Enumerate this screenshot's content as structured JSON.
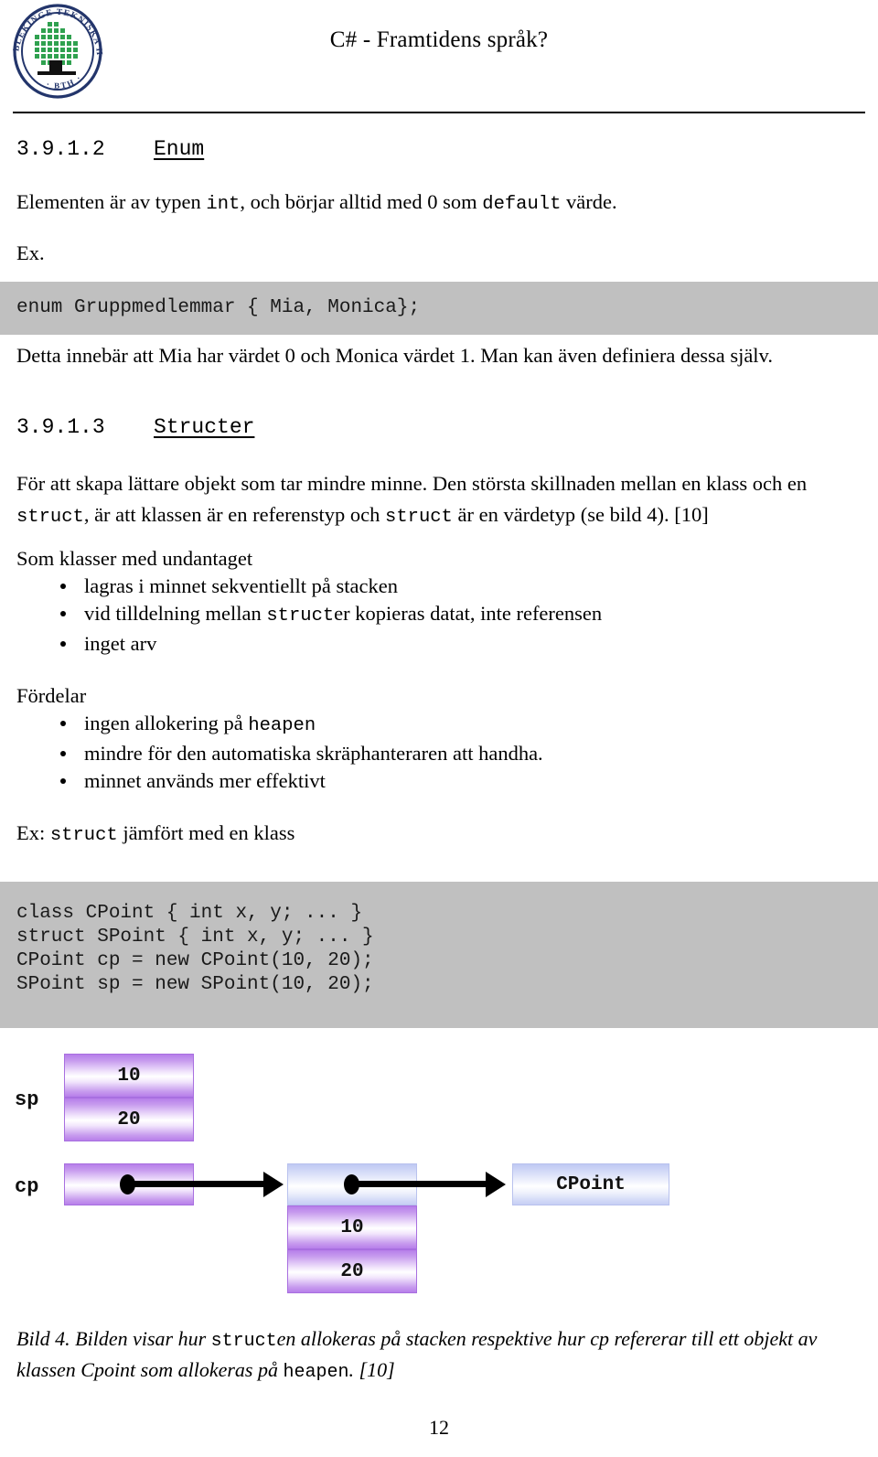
{
  "header": {
    "title": "C# - Framtidens språk?",
    "logo_alt": "Blekinge Tekniska Högskola BTH seal",
    "logo_text_top": "BLEKINGE TEKNISKA HÖGSKOLA",
    "logo_text_bottom": "BTH"
  },
  "sections": [
    {
      "number": "3.9.1.2",
      "title": "Enum",
      "paragraphs": [
        {
          "id": "enum_intro",
          "runs": [
            {
              "t": "Elementen är av typen ",
              "mono": false
            },
            {
              "t": "int",
              "mono": true
            },
            {
              "t": ", och börjar alltid med 0 som ",
              "mono": false
            },
            {
              "t": "default",
              "mono": true
            },
            {
              "t": " värde.",
              "mono": false
            }
          ]
        },
        {
          "id": "ex_label",
          "runs": [
            {
              "t": "Ex.",
              "mono": false
            }
          ]
        }
      ],
      "code": "enum Gruppmedlemmar { Mia, Monica};",
      "after_code": {
        "runs": [
          {
            "t": "Detta innebär att Mia har värdet 0 och Monica värdet 1. Man kan även definiera dessa själv.",
            "mono": false
          }
        ]
      }
    },
    {
      "number": "3.9.1.3",
      "title": "Structer",
      "paragraphs": [
        {
          "id": "struct_intro",
          "runs": [
            {
              "t": "För att skapa lättare objekt som tar mindre minne. Den största skillnaden mellan en klass och en ",
              "mono": false
            },
            {
              "t": "struct",
              "mono": true
            },
            {
              "t": ", är att klassen är en referenstyp och ",
              "mono": false
            },
            {
              "t": "struct",
              "mono": true
            },
            {
              "t": " är en värdetyp (se bild 4). [10]",
              "mono": false
            }
          ]
        }
      ]
    }
  ],
  "lists": [
    {
      "id": "som_klasser",
      "intro": "Som klasser med undantaget",
      "items": [
        [
          {
            "t": "lagras i minnet sekventiellt på stacken",
            "mono": false
          }
        ],
        [
          {
            "t": "vid tilldelning mellan ",
            "mono": false
          },
          {
            "t": "struct",
            "mono": true
          },
          {
            "t": "er kopieras datat, inte referensen",
            "mono": false
          }
        ],
        [
          {
            "t": "inget arv",
            "mono": false
          }
        ]
      ]
    },
    {
      "id": "fordelar",
      "intro": "Fördelar",
      "items": [
        [
          {
            "t": "ingen allokering på ",
            "mono": false
          },
          {
            "t": "heapen",
            "mono": true
          }
        ],
        [
          {
            "t": "mindre för den automatiska skräphanteraren att handha.",
            "mono": false
          }
        ],
        [
          {
            "t": "minnet används mer effektivt",
            "mono": false
          }
        ]
      ]
    }
  ],
  "example_intro": {
    "runs": [
      {
        "t": "Ex: ",
        "mono": false
      },
      {
        "t": "struct",
        "mono": true
      },
      {
        "t": " jämfört med en klass",
        "mono": false
      }
    ]
  },
  "code_block": "class CPoint { int x, y; ... }\nstruct SPoint { int x, y; ... }\nCPoint cp = new CPoint(10, 20);\nSPoint sp = new SPoint(10, 20);",
  "diagram": {
    "stack_var_label": "sp",
    "heap_var_label": "cp",
    "sp_values": [
      "10",
      "20"
    ],
    "heap_object_values": [
      "10",
      "20"
    ],
    "class_box_label": "CPoint",
    "colors": {
      "value_box": "#b47ae9",
      "reference_box": "#bcc6f2",
      "arrow": "#000000"
    }
  },
  "caption": {
    "runs": [
      {
        "t": "Bild 4. Bilden visar hur ",
        "mono": false
      },
      {
        "t": "struct",
        "mono": true
      },
      {
        "t": "en allokeras på stacken respektive hur cp refererar till ett objekt av klassen Cpoint som allokeras på ",
        "mono": false
      },
      {
        "t": "heapen",
        "mono": true
      },
      {
        "t": ". [10]",
        "mono": false
      }
    ]
  },
  "page_number": "12"
}
